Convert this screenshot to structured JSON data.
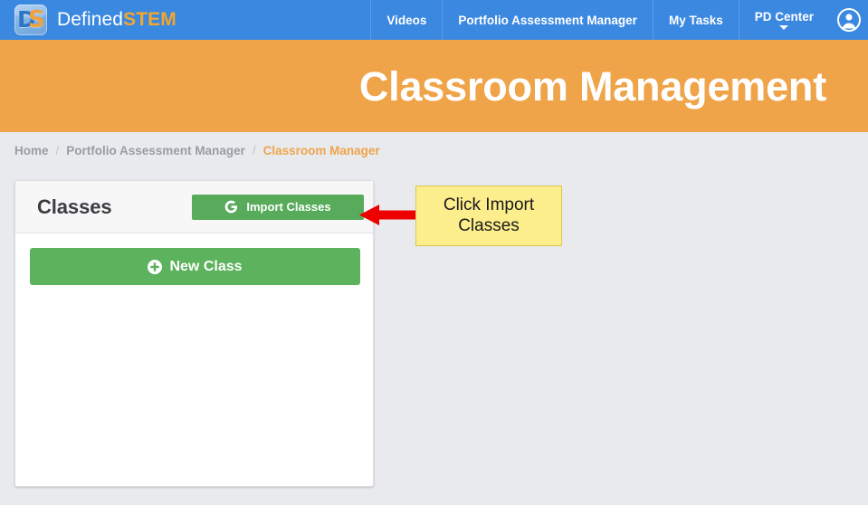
{
  "navbar": {
    "brand": {
      "text_plain": "Defined",
      "text_bold": "STEM",
      "logo_letters": "DS"
    },
    "items": [
      {
        "label": "Videos",
        "has_caret": false
      },
      {
        "label": "Portfolio Assessment Manager",
        "has_caret": false
      },
      {
        "label": "My Tasks",
        "has_caret": false
      },
      {
        "label": "PD Center",
        "has_caret": true
      }
    ],
    "avatar_icon": "user-circle-icon"
  },
  "banner": {
    "title": "Classroom Management",
    "background_color": "#efa449"
  },
  "breadcrumb": {
    "items": [
      {
        "label": "Home",
        "active": false
      },
      {
        "label": "Portfolio Assessment Manager",
        "active": false
      },
      {
        "label": "Classroom Manager",
        "active": true
      }
    ],
    "separator": "/",
    "active_color": "#efa449"
  },
  "card": {
    "title": "Classes",
    "import_button": {
      "label": "Import Classes",
      "icon": "google-g-icon",
      "color": "#57ab5a"
    },
    "new_class_button": {
      "label": "New Class",
      "icon": "plus-circle-icon",
      "color": "#5cb25d"
    }
  },
  "annotation": {
    "callout_text": "Click Import Classes",
    "callout_background": "#fced8d",
    "arrow_color": "#ee0000",
    "arrow_direction": "left"
  }
}
